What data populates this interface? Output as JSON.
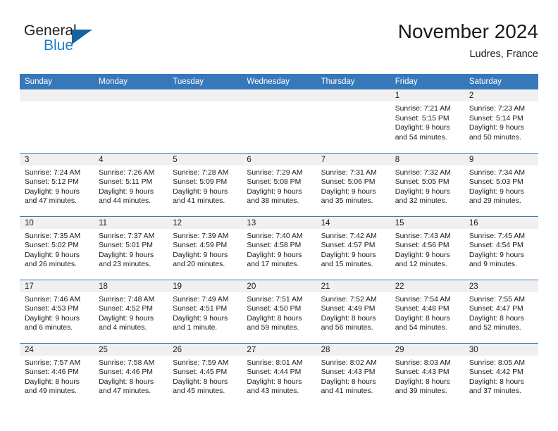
{
  "brand": {
    "name_top": "General",
    "name_bottom": "Blue",
    "triangle_color": "#14639e",
    "blue_color": "#1f7dc4"
  },
  "header": {
    "title": "November 2024",
    "subtitle": "Ludres, France"
  },
  "theme": {
    "header_blue": "#3778bb",
    "date_strip_gray": "#f0f0f0",
    "text_color": "#1a1a1a"
  },
  "weekdays": [
    "Sunday",
    "Monday",
    "Tuesday",
    "Wednesday",
    "Thursday",
    "Friday",
    "Saturday"
  ],
  "weeks": [
    [
      {
        "empty": true
      },
      {
        "empty": true
      },
      {
        "empty": true
      },
      {
        "empty": true
      },
      {
        "empty": true
      },
      {
        "day": "1",
        "sunrise": "Sunrise: 7:21 AM",
        "sunset": "Sunset: 5:15 PM",
        "daylight1": "Daylight: 9 hours",
        "daylight2": "and 54 minutes."
      },
      {
        "day": "2",
        "sunrise": "Sunrise: 7:23 AM",
        "sunset": "Sunset: 5:14 PM",
        "daylight1": "Daylight: 9 hours",
        "daylight2": "and 50 minutes."
      }
    ],
    [
      {
        "day": "3",
        "sunrise": "Sunrise: 7:24 AM",
        "sunset": "Sunset: 5:12 PM",
        "daylight1": "Daylight: 9 hours",
        "daylight2": "and 47 minutes."
      },
      {
        "day": "4",
        "sunrise": "Sunrise: 7:26 AM",
        "sunset": "Sunset: 5:11 PM",
        "daylight1": "Daylight: 9 hours",
        "daylight2": "and 44 minutes."
      },
      {
        "day": "5",
        "sunrise": "Sunrise: 7:28 AM",
        "sunset": "Sunset: 5:09 PM",
        "daylight1": "Daylight: 9 hours",
        "daylight2": "and 41 minutes."
      },
      {
        "day": "6",
        "sunrise": "Sunrise: 7:29 AM",
        "sunset": "Sunset: 5:08 PM",
        "daylight1": "Daylight: 9 hours",
        "daylight2": "and 38 minutes."
      },
      {
        "day": "7",
        "sunrise": "Sunrise: 7:31 AM",
        "sunset": "Sunset: 5:06 PM",
        "daylight1": "Daylight: 9 hours",
        "daylight2": "and 35 minutes."
      },
      {
        "day": "8",
        "sunrise": "Sunrise: 7:32 AM",
        "sunset": "Sunset: 5:05 PM",
        "daylight1": "Daylight: 9 hours",
        "daylight2": "and 32 minutes."
      },
      {
        "day": "9",
        "sunrise": "Sunrise: 7:34 AM",
        "sunset": "Sunset: 5:03 PM",
        "daylight1": "Daylight: 9 hours",
        "daylight2": "and 29 minutes."
      }
    ],
    [
      {
        "day": "10",
        "sunrise": "Sunrise: 7:35 AM",
        "sunset": "Sunset: 5:02 PM",
        "daylight1": "Daylight: 9 hours",
        "daylight2": "and 26 minutes."
      },
      {
        "day": "11",
        "sunrise": "Sunrise: 7:37 AM",
        "sunset": "Sunset: 5:01 PM",
        "daylight1": "Daylight: 9 hours",
        "daylight2": "and 23 minutes."
      },
      {
        "day": "12",
        "sunrise": "Sunrise: 7:39 AM",
        "sunset": "Sunset: 4:59 PM",
        "daylight1": "Daylight: 9 hours",
        "daylight2": "and 20 minutes."
      },
      {
        "day": "13",
        "sunrise": "Sunrise: 7:40 AM",
        "sunset": "Sunset: 4:58 PM",
        "daylight1": "Daylight: 9 hours",
        "daylight2": "and 17 minutes."
      },
      {
        "day": "14",
        "sunrise": "Sunrise: 7:42 AM",
        "sunset": "Sunset: 4:57 PM",
        "daylight1": "Daylight: 9 hours",
        "daylight2": "and 15 minutes."
      },
      {
        "day": "15",
        "sunrise": "Sunrise: 7:43 AM",
        "sunset": "Sunset: 4:56 PM",
        "daylight1": "Daylight: 9 hours",
        "daylight2": "and 12 minutes."
      },
      {
        "day": "16",
        "sunrise": "Sunrise: 7:45 AM",
        "sunset": "Sunset: 4:54 PM",
        "daylight1": "Daylight: 9 hours",
        "daylight2": "and 9 minutes."
      }
    ],
    [
      {
        "day": "17",
        "sunrise": "Sunrise: 7:46 AM",
        "sunset": "Sunset: 4:53 PM",
        "daylight1": "Daylight: 9 hours",
        "daylight2": "and 6 minutes."
      },
      {
        "day": "18",
        "sunrise": "Sunrise: 7:48 AM",
        "sunset": "Sunset: 4:52 PM",
        "daylight1": "Daylight: 9 hours",
        "daylight2": "and 4 minutes."
      },
      {
        "day": "19",
        "sunrise": "Sunrise: 7:49 AM",
        "sunset": "Sunset: 4:51 PM",
        "daylight1": "Daylight: 9 hours",
        "daylight2": "and 1 minute."
      },
      {
        "day": "20",
        "sunrise": "Sunrise: 7:51 AM",
        "sunset": "Sunset: 4:50 PM",
        "daylight1": "Daylight: 8 hours",
        "daylight2": "and 59 minutes."
      },
      {
        "day": "21",
        "sunrise": "Sunrise: 7:52 AM",
        "sunset": "Sunset: 4:49 PM",
        "daylight1": "Daylight: 8 hours",
        "daylight2": "and 56 minutes."
      },
      {
        "day": "22",
        "sunrise": "Sunrise: 7:54 AM",
        "sunset": "Sunset: 4:48 PM",
        "daylight1": "Daylight: 8 hours",
        "daylight2": "and 54 minutes."
      },
      {
        "day": "23",
        "sunrise": "Sunrise: 7:55 AM",
        "sunset": "Sunset: 4:47 PM",
        "daylight1": "Daylight: 8 hours",
        "daylight2": "and 52 minutes."
      }
    ],
    [
      {
        "day": "24",
        "sunrise": "Sunrise: 7:57 AM",
        "sunset": "Sunset: 4:46 PM",
        "daylight1": "Daylight: 8 hours",
        "daylight2": "and 49 minutes."
      },
      {
        "day": "25",
        "sunrise": "Sunrise: 7:58 AM",
        "sunset": "Sunset: 4:46 PM",
        "daylight1": "Daylight: 8 hours",
        "daylight2": "and 47 minutes."
      },
      {
        "day": "26",
        "sunrise": "Sunrise: 7:59 AM",
        "sunset": "Sunset: 4:45 PM",
        "daylight1": "Daylight: 8 hours",
        "daylight2": "and 45 minutes."
      },
      {
        "day": "27",
        "sunrise": "Sunrise: 8:01 AM",
        "sunset": "Sunset: 4:44 PM",
        "daylight1": "Daylight: 8 hours",
        "daylight2": "and 43 minutes."
      },
      {
        "day": "28",
        "sunrise": "Sunrise: 8:02 AM",
        "sunset": "Sunset: 4:43 PM",
        "daylight1": "Daylight: 8 hours",
        "daylight2": "and 41 minutes."
      },
      {
        "day": "29",
        "sunrise": "Sunrise: 8:03 AM",
        "sunset": "Sunset: 4:43 PM",
        "daylight1": "Daylight: 8 hours",
        "daylight2": "and 39 minutes."
      },
      {
        "day": "30",
        "sunrise": "Sunrise: 8:05 AM",
        "sunset": "Sunset: 4:42 PM",
        "daylight1": "Daylight: 8 hours",
        "daylight2": "and 37 minutes."
      }
    ]
  ]
}
